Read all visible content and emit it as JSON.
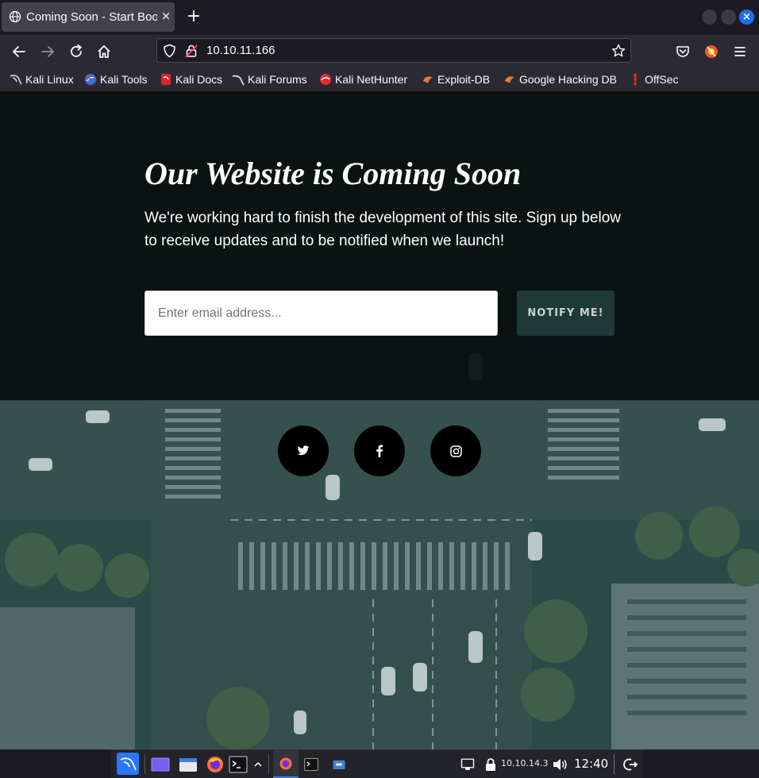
{
  "browser": {
    "tab_title": "Coming Soon - Start Bootstrap",
    "tab_close": "×",
    "new_tab": "+",
    "url": "10.10.11.166",
    "bookmarks": [
      {
        "label": "Kali Linux",
        "icon": "kali-dragon-icon"
      },
      {
        "label": "Kali Tools",
        "icon": "kali-tools-icon"
      },
      {
        "label": "Kali Docs",
        "icon": "kali-docs-icon"
      },
      {
        "label": "Kali Forums",
        "icon": "kali-forums-icon"
      },
      {
        "label": "Kali NetHunter",
        "icon": "nethunter-icon"
      },
      {
        "label": "Exploit-DB",
        "icon": "exploit-db-icon"
      },
      {
        "label": "Google Hacking DB",
        "icon": "ghdb-icon"
      },
      {
        "label": "OffSec",
        "icon": "offsec-icon"
      }
    ]
  },
  "page": {
    "headline": "Our Website is Coming Soon",
    "subtext": "We're working hard to finish the development of this site. Sign up below to receive updates and to be notified when we launch!",
    "email_placeholder": "Enter email address...",
    "notify_label": "NOTIFY ME!",
    "social": [
      "twitter-icon",
      "facebook-icon",
      "instagram-icon"
    ]
  },
  "taskbar": {
    "ip": "10.10.14.3",
    "clock": "12:40"
  },
  "colors": {
    "hero_overlay": "#080e0e",
    "teal_overlay": "#2f4e4a",
    "notify_button": "#1f3a36",
    "accent_blue": "#1d6ff2"
  }
}
